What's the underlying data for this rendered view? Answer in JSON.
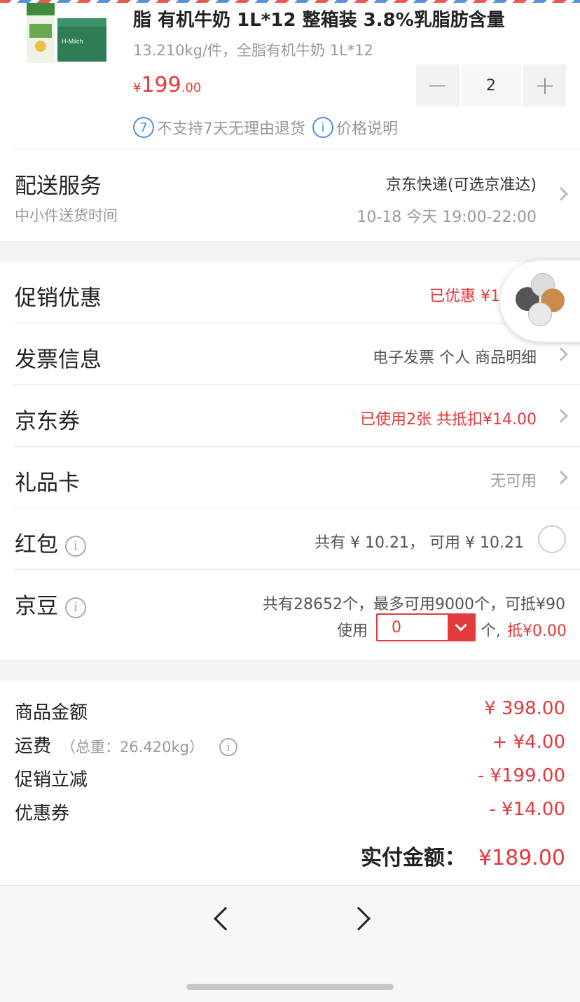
{
  "product": {
    "title": "脂 有机牛奶 1L*12 整箱装 3.8%乳脂肪含量",
    "spec": "13.210kg/件，全脂有机牛奶 1L*12",
    "price_currency": "¥",
    "price_int": "199",
    "price_dec": ".00",
    "quantity": "2",
    "minus": "−",
    "plus": "+",
    "no_return": "不支持7天无理由退货",
    "price_note": "价格说明",
    "image_text": "H-Milch"
  },
  "delivery": {
    "label": "配送服务",
    "sublabel": "中小件送货时间",
    "method": "京东快递(可选京准达)",
    "time": "10-18 今天 19:00-22:00"
  },
  "rows": {
    "promo": {
      "label": "促销优惠",
      "value": "已优惠 ¥19"
    },
    "invoice": {
      "label": "发票信息",
      "value": "电子发票 个人 商品明细"
    },
    "coupon": {
      "label": "京东券",
      "value": "已使用2张 共抵扣¥14.00"
    },
    "giftcard": {
      "label": "礼品卡",
      "value": "无可用"
    },
    "redpacket": {
      "label": "红包",
      "value": "共有 ¥ 10.21， 可用 ¥ 10.21"
    },
    "jingdou": {
      "label": "京豆",
      "summary": "共有28652个，最多可用9000个，可抵¥90",
      "use": "使用",
      "input": "0",
      "unit": "个,",
      "deduct": "抵¥0.00"
    }
  },
  "summary": {
    "goods_label": "商品金额",
    "goods_value": "¥ 398.00",
    "shipping_label": "运费",
    "weight": "（总重：26.420kg）",
    "shipping_value": "+ ¥4.00",
    "promo_label": "促销立减",
    "promo_value": "- ¥199.00",
    "coupon_label": "优惠券",
    "coupon_value": "- ¥14.00",
    "total_label": "实付金额：",
    "total_value": "¥189.00"
  },
  "info_glyph": "i",
  "no_return_glyph": "7",
  "colors": {
    "accent": "#e4393c",
    "link": "#4a8fe0"
  }
}
